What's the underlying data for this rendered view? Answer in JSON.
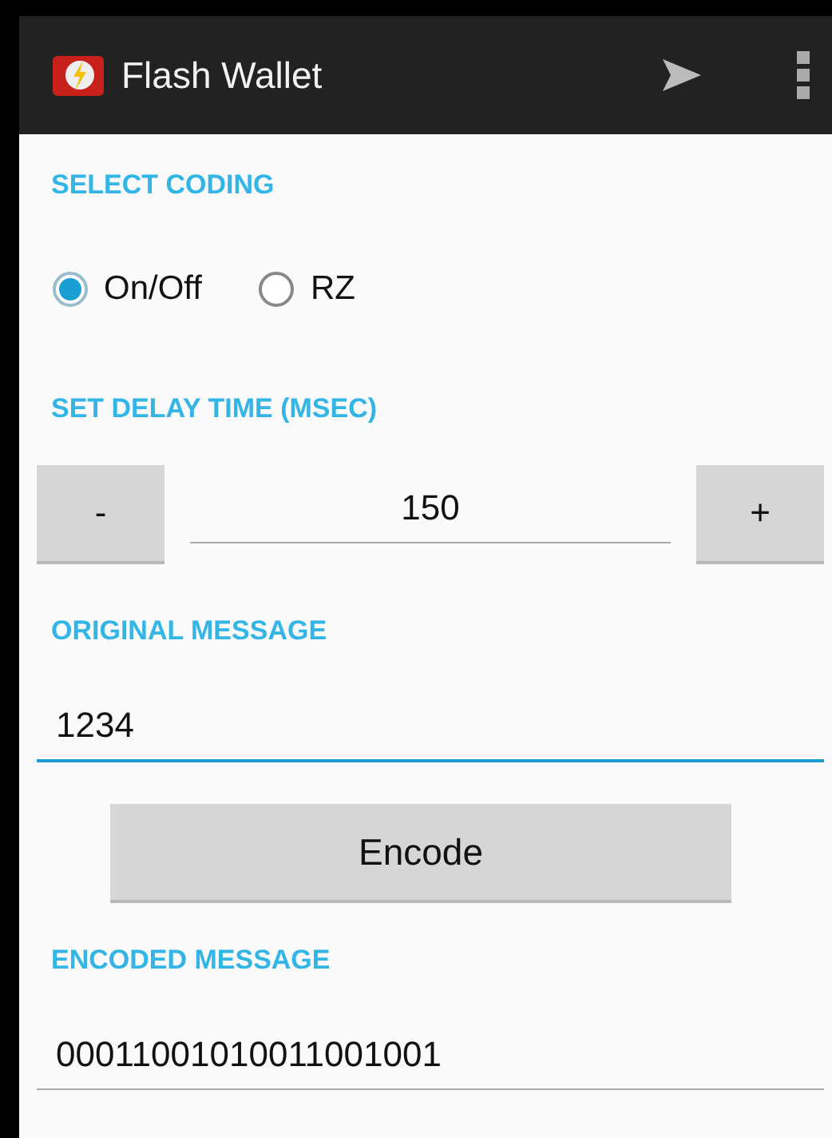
{
  "action_bar": {
    "title": "Flash Wallet"
  },
  "coding": {
    "heading": "SELECT CODING",
    "options": [
      {
        "label": "On/Off",
        "selected": true
      },
      {
        "label": "RZ",
        "selected": false
      }
    ]
  },
  "delay": {
    "heading": "SET DELAY TIME (MSEC)",
    "minus": "-",
    "value": "150",
    "plus": "+"
  },
  "original": {
    "heading": "ORIGINAL MESSAGE",
    "value": "1234",
    "focused": true
  },
  "encode_button": "Encode",
  "encoded": {
    "heading": "ENCODED MESSAGE",
    "value": "00011001010011001001",
    "focused": false
  }
}
